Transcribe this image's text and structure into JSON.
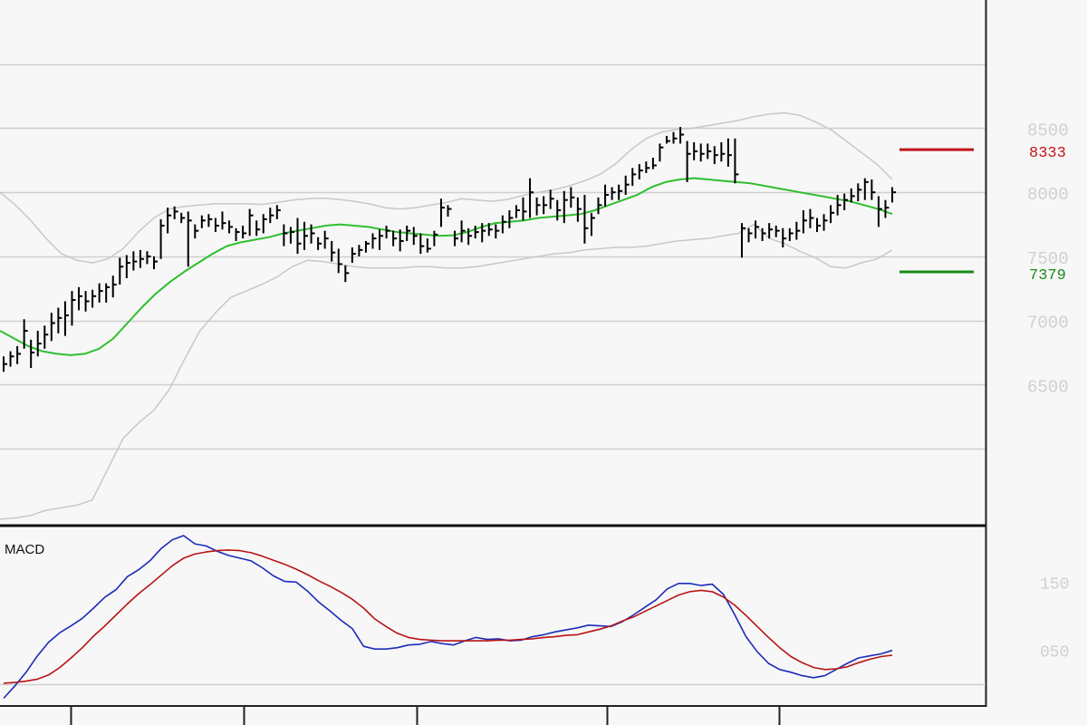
{
  "chart_data": [
    {
      "type": "ohlc",
      "panel": "price",
      "ylim": [
        5400,
        9500
      ],
      "yticks": [
        6500,
        7000,
        7500,
        8000,
        8500
      ],
      "ytick_labels": [
        "6500",
        "7000",
        "7500",
        "8000",
        "8500"
      ],
      "grid": true,
      "markers": [
        {
          "value": 8333,
          "label": "8333",
          "color": "#c0141b"
        },
        {
          "value": 7379,
          "label": "7379",
          "color": "#1a8a1a"
        }
      ],
      "bars": [
        [
          6720,
          6600,
          6660
        ],
        [
          6760,
          6640,
          6720
        ],
        [
          6800,
          6660,
          6740
        ],
        [
          7010,
          6780,
          6920
        ],
        [
          6850,
          6630,
          6750
        ],
        [
          6920,
          6720,
          6820
        ],
        [
          6960,
          6780,
          6890
        ],
        [
          7060,
          6840,
          6980
        ],
        [
          7100,
          6900,
          7020
        ],
        [
          7150,
          6880,
          7040
        ],
        [
          7230,
          6960,
          7160
        ],
        [
          7260,
          7080,
          7190
        ],
        [
          7230,
          7070,
          7150
        ],
        [
          7240,
          7100,
          7190
        ],
        [
          7290,
          7140,
          7230
        ],
        [
          7290,
          7140,
          7260
        ],
        [
          7350,
          7180,
          7280
        ],
        [
          7490,
          7280,
          7420
        ],
        [
          7510,
          7330,
          7450
        ],
        [
          7540,
          7390,
          7460
        ],
        [
          7550,
          7410,
          7480
        ],
        [
          7540,
          7440,
          7500
        ],
        [
          7500,
          7400,
          7460
        ],
        [
          7790,
          7480,
          7740
        ],
        [
          7880,
          7680,
          7820
        ],
        [
          7890,
          7790,
          7850
        ],
        [
          7840,
          7760,
          7800
        ],
        [
          7850,
          7420,
          7780
        ],
        [
          7750,
          7640,
          7700
        ],
        [
          7820,
          7720,
          7780
        ],
        [
          7830,
          7730,
          7790
        ],
        [
          7800,
          7690,
          7740
        ],
        [
          7850,
          7710,
          7760
        ],
        [
          7780,
          7680,
          7730
        ],
        [
          7720,
          7620,
          7690
        ],
        [
          7740,
          7640,
          7680
        ],
        [
          7870,
          7660,
          7820
        ],
        [
          7780,
          7660,
          7710
        ],
        [
          7830,
          7680,
          7790
        ],
        [
          7880,
          7760,
          7820
        ],
        [
          7900,
          7790,
          7860
        ],
        [
          7750,
          7580,
          7680
        ],
        [
          7730,
          7600,
          7690
        ],
        [
          7800,
          7520,
          7600
        ],
        [
          7770,
          7550,
          7660
        ],
        [
          7750,
          7600,
          7680
        ],
        [
          7650,
          7550,
          7600
        ],
        [
          7700,
          7560,
          7640
        ],
        [
          7620,
          7460,
          7530
        ],
        [
          7560,
          7370,
          7440
        ],
        [
          7430,
          7300,
          7370
        ],
        [
          7570,
          7450,
          7520
        ],
        [
          7590,
          7500,
          7550
        ],
        [
          7620,
          7530,
          7600
        ],
        [
          7680,
          7560,
          7640
        ],
        [
          7710,
          7550,
          7660
        ],
        [
          7740,
          7640,
          7700
        ],
        [
          7700,
          7580,
          7640
        ],
        [
          7710,
          7540,
          7620
        ],
        [
          7740,
          7620,
          7700
        ],
        [
          7730,
          7590,
          7660
        ],
        [
          7680,
          7520,
          7580
        ],
        [
          7640,
          7530,
          7560
        ],
        [
          7700,
          7580,
          7670
        ],
        [
          7950,
          7730,
          7880
        ],
        [
          7900,
          7810,
          7870
        ],
        [
          7700,
          7580,
          7640
        ],
        [
          7780,
          7610,
          7700
        ],
        [
          7720,
          7590,
          7660
        ],
        [
          7740,
          7640,
          7690
        ],
        [
          7760,
          7610,
          7700
        ],
        [
          7760,
          7660,
          7710
        ],
        [
          7750,
          7640,
          7700
        ],
        [
          7820,
          7680,
          7770
        ],
        [
          7860,
          7720,
          7800
        ],
        [
          7900,
          7800,
          7860
        ],
        [
          7960,
          7780,
          7850
        ],
        [
          8110,
          7800,
          8000
        ],
        [
          7960,
          7820,
          7900
        ],
        [
          7970,
          7830,
          7900
        ],
        [
          8020,
          7870,
          7950
        ],
        [
          7940,
          7780,
          7860
        ],
        [
          8010,
          7760,
          7940
        ],
        [
          8040,
          7880,
          7960
        ],
        [
          7960,
          7770,
          7870
        ],
        [
          7980,
          7600,
          7720
        ],
        [
          7840,
          7660,
          7800
        ],
        [
          7960,
          7830,
          7900
        ],
        [
          8060,
          7890,
          7980
        ],
        [
          8040,
          7940,
          8000
        ],
        [
          8060,
          7940,
          8010
        ],
        [
          8130,
          7980,
          8060
        ],
        [
          8190,
          8050,
          8140
        ],
        [
          8220,
          8100,
          8170
        ],
        [
          8240,
          8150,
          8190
        ],
        [
          8270,
          8180,
          8210
        ],
        [
          8380,
          8240,
          8350
        ],
        [
          8440,
          8380,
          8400
        ],
        [
          8470,
          8380,
          8420
        ],
        [
          8510,
          8380,
          8450
        ],
        [
          8400,
          8080,
          8300
        ],
        [
          8390,
          8250,
          8320
        ],
        [
          8380,
          8240,
          8300
        ],
        [
          8380,
          8260,
          8320
        ],
        [
          8360,
          8220,
          8290
        ],
        [
          8390,
          8240,
          8300
        ],
        [
          8420,
          8200,
          8290
        ],
        [
          8420,
          8070,
          8140
        ],
        [
          7760,
          7490,
          7720
        ],
        [
          7720,
          7610,
          7680
        ],
        [
          7780,
          7640,
          7730
        ],
        [
          7720,
          7620,
          7680
        ],
        [
          7760,
          7640,
          7710
        ],
        [
          7740,
          7650,
          7700
        ],
        [
          7720,
          7570,
          7640
        ],
        [
          7720,
          7620,
          7680
        ],
        [
          7770,
          7630,
          7700
        ],
        [
          7860,
          7680,
          7780
        ],
        [
          7870,
          7720,
          7800
        ],
        [
          7800,
          7690,
          7740
        ],
        [
          7830,
          7700,
          7780
        ],
        [
          7900,
          7760,
          7840
        ],
        [
          7980,
          7820,
          7900
        ],
        [
          7990,
          7860,
          7940
        ],
        [
          8030,
          7920,
          7970
        ],
        [
          8070,
          7930,
          8020
        ],
        [
          8110,
          7940,
          8080
        ],
        [
          8100,
          7940,
          8000
        ],
        [
          7970,
          7730,
          7870
        ],
        [
          7940,
          7800,
          7880
        ],
        [
          8040,
          7920,
          8000
        ]
      ],
      "series": [
        {
          "type": "line",
          "role": "sma",
          "color": "#2fbf2f",
          "values": [
            6920,
            6860,
            6800,
            6760,
            6740,
            6730,
            6740,
            6780,
            6860,
            6980,
            7100,
            7210,
            7300,
            7380,
            7450,
            7520,
            7580,
            7610,
            7630,
            7650,
            7680,
            7700,
            7720,
            7740,
            7750,
            7740,
            7730,
            7710,
            7690,
            7680,
            7670,
            7660,
            7665,
            7690,
            7730,
            7760,
            7770,
            7780,
            7800,
            7810,
            7820,
            7830,
            7860,
            7900,
            7940,
            7980,
            8040,
            8080,
            8100,
            8110,
            8100,
            8090,
            8080,
            8070,
            8050,
            8030,
            8010,
            7990,
            7970,
            7950,
            7930,
            7900,
            7870,
            7830
          ]
        },
        {
          "type": "line",
          "role": "upper-band",
          "color": "#c8c8c8",
          "values": [
            8000,
            7900,
            7780,
            7640,
            7520,
            7470,
            7450,
            7480,
            7560,
            7690,
            7800,
            7870,
            7890,
            7900,
            7910,
            7910,
            7910,
            7905,
            7920,
            7940,
            7950,
            7955,
            7945,
            7930,
            7910,
            7880,
            7870,
            7880,
            7900,
            7920,
            7950,
            7940,
            7930,
            7945,
            7975,
            8000,
            8020,
            8050,
            8090,
            8140,
            8220,
            8330,
            8420,
            8470,
            8490,
            8500,
            8520,
            8540,
            8560,
            8590,
            8610,
            8620,
            8600,
            8550,
            8490,
            8400,
            8310,
            8220,
            8100
          ]
        },
        {
          "type": "line",
          "role": "lower-band",
          "color": "#c8c8c8",
          "values": [
            5450,
            5460,
            5480,
            5520,
            5540,
            5560,
            5600,
            5840,
            6080,
            6200,
            6300,
            6460,
            6700,
            6920,
            7060,
            7180,
            7230,
            7280,
            7340,
            7420,
            7470,
            7460,
            7440,
            7420,
            7410,
            7410,
            7410,
            7420,
            7420,
            7410,
            7410,
            7420,
            7440,
            7460,
            7480,
            7500,
            7520,
            7530,
            7550,
            7560,
            7570,
            7570,
            7580,
            7600,
            7620,
            7630,
            7640,
            7660,
            7680,
            7750,
            7640,
            7600,
            7540,
            7490,
            7420,
            7410,
            7450,
            7480,
            7550
          ]
        }
      ]
    },
    {
      "type": "line",
      "panel": "macd",
      "title": "MACD",
      "ylim": [
        -0.3,
        2.3
      ],
      "yticks": [
        0.5,
        1.5
      ],
      "ytick_labels": [
        "050",
        "150"
      ],
      "grid": true,
      "series": [
        {
          "role": "macd",
          "color": "#1c2bb8",
          "values": [
            -0.2,
            -0.02,
            0.18,
            0.42,
            0.62,
            0.76,
            0.86,
            0.97,
            1.12,
            1.28,
            1.39,
            1.58,
            1.68,
            1.81,
            1.99,
            2.12,
            2.18,
            2.06,
            2.03,
            1.95,
            1.89,
            1.85,
            1.81,
            1.71,
            1.59,
            1.51,
            1.5,
            1.37,
            1.21,
            1.08,
            0.94,
            0.82,
            0.56,
            0.52,
            0.52,
            0.54,
            0.58,
            0.59,
            0.63,
            0.6,
            0.58,
            0.64,
            0.69,
            0.66,
            0.67,
            0.64,
            0.65,
            0.7,
            0.73,
            0.77,
            0.8,
            0.83,
            0.87,
            0.86,
            0.85,
            0.92,
            1.02,
            1.13,
            1.24,
            1.4,
            1.48,
            1.48,
            1.45,
            1.47,
            1.32,
            1.02,
            0.7,
            0.48,
            0.31,
            0.22,
            0.18,
            0.13,
            0.1,
            0.13,
            0.22,
            0.31,
            0.39,
            0.42,
            0.45,
            0.5
          ]
        },
        {
          "role": "signal",
          "color": "#b81414",
          "values": [
            0.02,
            0.03,
            0.05,
            0.08,
            0.14,
            0.25,
            0.39,
            0.54,
            0.71,
            0.86,
            1.02,
            1.18,
            1.33,
            1.46,
            1.6,
            1.74,
            1.85,
            1.91,
            1.94,
            1.96,
            1.97,
            1.96,
            1.93,
            1.88,
            1.82,
            1.76,
            1.69,
            1.61,
            1.52,
            1.44,
            1.35,
            1.25,
            1.12,
            0.96,
            0.85,
            0.75,
            0.69,
            0.66,
            0.65,
            0.64,
            0.64,
            0.64,
            0.64,
            0.64,
            0.65,
            0.65,
            0.66,
            0.67,
            0.69,
            0.7,
            0.72,
            0.73,
            0.77,
            0.81,
            0.86,
            0.93,
            0.99,
            1.07,
            1.15,
            1.23,
            1.31,
            1.36,
            1.38,
            1.36,
            1.28,
            1.16,
            1.01,
            0.85,
            0.69,
            0.54,
            0.41,
            0.32,
            0.25,
            0.22,
            0.23,
            0.26,
            0.32,
            0.37,
            0.41,
            0.43
          ]
        }
      ]
    }
  ]
}
